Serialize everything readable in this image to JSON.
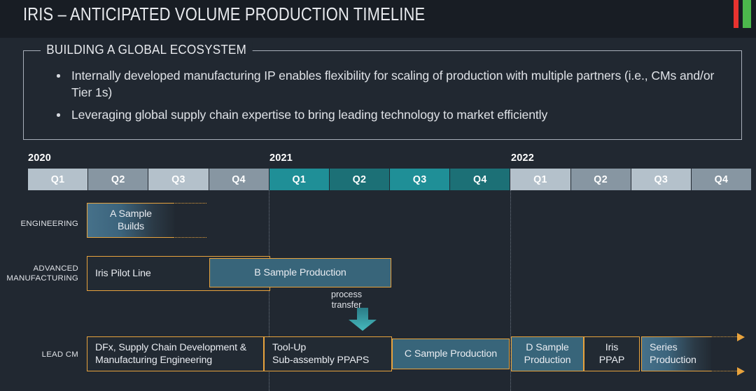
{
  "header": {
    "title": "IRIS – ANTICIPATED VOLUME PRODUCTION TIMELINE",
    "accent_red": "#e8332f",
    "accent_green": "#4cb84c"
  },
  "callout": {
    "title": "BUILDING A GLOBAL ECOSYSTEM",
    "bullets": [
      "Internally developed manufacturing IP enables flexibility for scaling of production with multiple partners (i.e., CMs and/or Tier 1s)",
      "Leveraging global supply chain expertise to bring leading technology to market efficiently"
    ]
  },
  "timeline": {
    "years": [
      "2020",
      "2021",
      "2022"
    ],
    "quarters": [
      "Q1",
      "Q2",
      "Q3",
      "Q4",
      "Q1",
      "Q2",
      "Q3",
      "Q4",
      "Q1",
      "Q2",
      "Q3",
      "Q4"
    ],
    "colors": {
      "quarter_light": "#b4c1cb",
      "quarter_dark": "#8796a2",
      "quarter_teal_light": "#1f8f97",
      "quarter_teal_dark": "#1c7076",
      "box_border": "#e8a33d",
      "box_fill_blue": "#38657a",
      "box_fill_dark": "#222a33",
      "background": "#212831",
      "header_background": "#181d24"
    }
  },
  "rows": [
    {
      "label": "ENGINEERING"
    },
    {
      "label_line1": "ADVANCED",
      "label_line2": "MANUFACTURING"
    },
    {
      "label": "LEAD CM"
    }
  ],
  "tasks": {
    "a_sample_builds": "A Sample\nBuilds",
    "a_sample_builds_l1": "A Sample",
    "a_sample_builds_l2": "Builds",
    "iris_pilot_line": "Iris Pilot Line",
    "b_sample_production": "B Sample Production",
    "process_transfer_l1": "process",
    "process_transfer_l2": "transfer",
    "dfx_l1": "DFx, Supply Chain Development &",
    "dfx_l2": "Manufacturing Engineering",
    "toolup_l1": "Tool-Up",
    "toolup_l2": "Sub-assembly PPAPS",
    "c_sample_production": "C Sample Production",
    "d_sample_production_l1": "D Sample",
    "d_sample_production_l2": "Production",
    "iris_ppap_l1": "Iris",
    "iris_ppap_l2": "PPAP",
    "series_production_l1": "Series",
    "series_production_l2": "Production"
  }
}
